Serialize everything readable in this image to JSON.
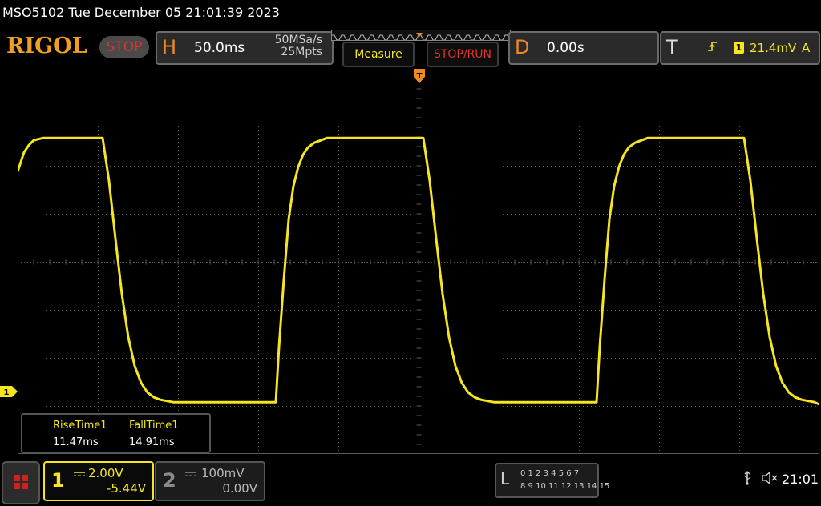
{
  "title": "MSO5102  Tue December 05 21:01:39 2023",
  "brand": "RIGOL",
  "run_state": "STOP",
  "horizontal": {
    "letter": "H",
    "timebase": "50.0ms",
    "sample_rate": "50MSa/s",
    "memory_depth": "25Mpts"
  },
  "buttons": {
    "measure": "Measure",
    "stop_run": "STOP/RUN"
  },
  "delay": {
    "letter": "D",
    "value": "0.00s"
  },
  "trigger": {
    "letter": "T",
    "edge_icon": "rising-edge-icon",
    "source": "1",
    "level": "21.4mV",
    "mode": "A"
  },
  "measurements": [
    {
      "name": "RiseTime1",
      "value": "11.47ms"
    },
    {
      "name": "FallTime1",
      "value": "14.91ms"
    }
  ],
  "channels": [
    {
      "number": "1",
      "coupling": "DC",
      "scale": "2.00V",
      "offset": "-5.44V",
      "active": true
    },
    {
      "number": "2",
      "coupling": "DC",
      "scale": "100mV",
      "offset": "0.00V",
      "active": false
    }
  ],
  "logic": {
    "letter": "L",
    "row1": "0 1 2 3  4 5 6 7",
    "row2": "8 9 10 11 12 13 14 15"
  },
  "status": {
    "usb_icon": "usb-icon",
    "speaker_icon": "speaker-muted-icon",
    "clock": "21:01"
  },
  "colors": {
    "ch1": "#f5e620",
    "accent_orange": "#f08a20",
    "stop_red": "#e03030",
    "grid": "#5a5a5a"
  },
  "chart_data": {
    "type": "line",
    "title": "",
    "xlabel": "",
    "ylabel": "",
    "x_unit": "ms",
    "y_unit": "V",
    "xlim": [
      -250,
      250
    ],
    "ylim": [
      -2.56,
      13.44
    ],
    "series": [
      {
        "name": "1",
        "x": [
          -250,
          -248,
          -246,
          -243,
          -240,
          -234,
          -228,
          -222,
          -216,
          -210,
          -204,
          -198,
          -197,
          -193,
          -189,
          -185,
          -181,
          -177,
          -173,
          -169,
          -165,
          -161,
          -157,
          -153,
          -148,
          -138,
          -128,
          -118,
          -108,
          -98,
          -89,
          -87,
          -84,
          -81,
          -78,
          -75,
          -72,
          -69,
          -65,
          -61,
          -57,
          -53,
          -48,
          -38,
          -28,
          -18,
          -8,
          2,
          3,
          7,
          11,
          15,
          19,
          23,
          27,
          31,
          35,
          39,
          43,
          47,
          52,
          62,
          72,
          82,
          92,
          102,
          111,
          113,
          116,
          119,
          122,
          125,
          128,
          131,
          135,
          139,
          143,
          147,
          152,
          162,
          172,
          182,
          192,
          202,
          203,
          207,
          211,
          215,
          219,
          223,
          227,
          231,
          235,
          239,
          243,
          247,
          250
        ],
        "y": [
          9.2,
          9.6,
          10.0,
          10.3,
          10.5,
          10.6,
          10.6,
          10.6,
          10.6,
          10.6,
          10.6,
          10.6,
          10.6,
          8.8,
          6.4,
          4.1,
          2.3,
          1.1,
          0.4,
          0.0,
          -0.2,
          -0.3,
          -0.35,
          -0.4,
          -0.4,
          -0.4,
          -0.4,
          -0.4,
          -0.4,
          -0.4,
          -0.4,
          1.9,
          4.7,
          7.2,
          8.6,
          9.4,
          9.9,
          10.2,
          10.4,
          10.5,
          10.6,
          10.6,
          10.6,
          10.6,
          10.6,
          10.6,
          10.6,
          10.6,
          10.6,
          8.8,
          6.4,
          4.1,
          2.3,
          1.1,
          0.4,
          0.0,
          -0.2,
          -0.3,
          -0.35,
          -0.4,
          -0.4,
          -0.4,
          -0.4,
          -0.4,
          -0.4,
          -0.4,
          -0.4,
          1.9,
          4.7,
          7.2,
          8.6,
          9.4,
          9.9,
          10.2,
          10.4,
          10.5,
          10.6,
          10.6,
          10.6,
          10.6,
          10.6,
          10.6,
          10.6,
          10.6,
          10.6,
          8.8,
          6.4,
          4.1,
          2.3,
          1.1,
          0.4,
          0.0,
          -0.2,
          -0.3,
          -0.35,
          -0.4,
          -0.5
        ]
      }
    ],
    "grid": true,
    "divisions": {
      "x": 10,
      "y": 8
    }
  }
}
